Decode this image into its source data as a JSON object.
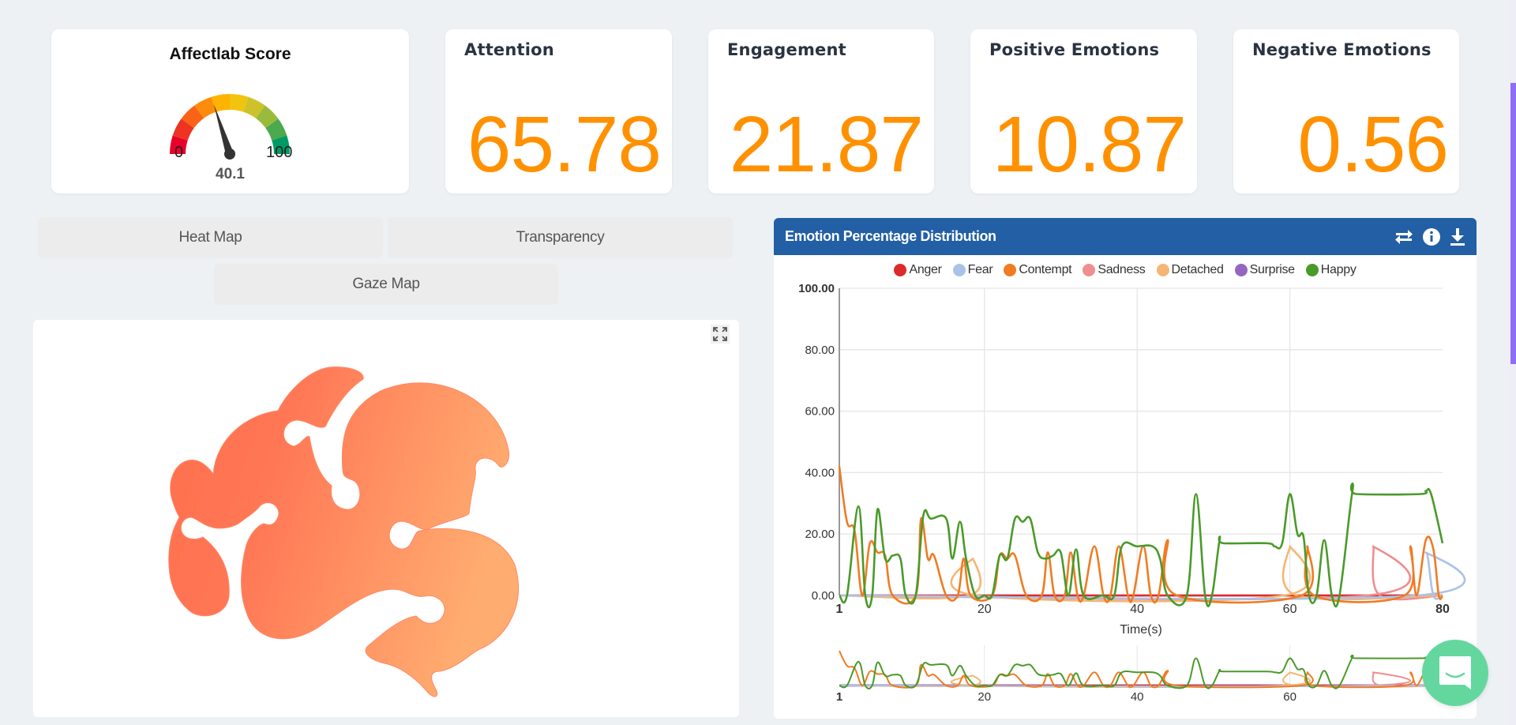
{
  "score_card": {
    "title": "Affectlab Score",
    "min_label": "0",
    "max_label": "100",
    "value": 40.1,
    "value_label": "40.1",
    "gauge_colors": [
      "#e8002a",
      "#ee3322",
      "#fa6216",
      "#fd8c0c",
      "#feb300",
      "#f1c40f",
      "#cdc22a",
      "#99bb3c",
      "#4ca94e",
      "#009a62"
    ]
  },
  "kpis": [
    {
      "title": "Attention",
      "value": "65.78"
    },
    {
      "title": "Engagement",
      "value": "21.87"
    },
    {
      "title": "Positive Emotions",
      "value": "10.87"
    },
    {
      "title": "Negative Emotions",
      "value": "0.56"
    }
  ],
  "view_buttons": {
    "heat_map": "Heat Map",
    "transparency": "Transparency",
    "gaze_map": "Gaze Map"
  },
  "image_panel": {
    "expand_icon": "expand-icon",
    "image": "brain-logo"
  },
  "chart_panel": {
    "title": "Emotion Percentage Distribution",
    "icons": [
      "swap-icon",
      "info-icon",
      "download-icon"
    ]
  },
  "chat_button": {
    "icon": "chat-bubble-icon"
  },
  "chart_data": {
    "type": "line",
    "title": "Emotion Percentage Distribution",
    "xlabel": "Time(s)",
    "ylabel": "",
    "xlim": [
      1,
      80
    ],
    "ylim": [
      0,
      100
    ],
    "xticks": [
      "1",
      "20",
      "40",
      "60",
      "80"
    ],
    "yticks": [
      "0.00",
      "20.00",
      "40.00",
      "60.00",
      "80.00",
      "100.00"
    ],
    "grid": true,
    "legend_position": "top",
    "navigator_xticks": [
      "1",
      "20",
      "40",
      "60"
    ],
    "series": [
      {
        "name": "Anger",
        "color": "#dd2a2a",
        "points": [
          [
            1,
            0
          ],
          [
            80,
            0
          ]
        ]
      },
      {
        "name": "Fear",
        "color": "#a9c3e8",
        "points": [
          [
            1,
            0
          ],
          [
            76.5,
            0
          ],
          [
            77.8,
            14
          ],
          [
            78.8,
            0
          ],
          [
            80,
            0
          ]
        ]
      },
      {
        "name": "Contempt",
        "color": "#f07b22",
        "points": [
          [
            1,
            42
          ],
          [
            2,
            24
          ],
          [
            3,
            21
          ],
          [
            4,
            0
          ],
          [
            5,
            17
          ],
          [
            6,
            14
          ],
          [
            7,
            13
          ],
          [
            8,
            0
          ],
          [
            11,
            0
          ],
          [
            11.7,
            25
          ],
          [
            12.6,
            12
          ],
          [
            13.4,
            13
          ],
          [
            15,
            0
          ],
          [
            16.5,
            0
          ],
          [
            17.3,
            12
          ],
          [
            18.2,
            0
          ],
          [
            21,
            0
          ],
          [
            22,
            13
          ],
          [
            23,
            12
          ],
          [
            24,
            13
          ],
          [
            25.5,
            0
          ],
          [
            27.5,
            0
          ],
          [
            28.3,
            14
          ],
          [
            29.2,
            0
          ],
          [
            30.5,
            0
          ],
          [
            31.3,
            14
          ],
          [
            32.2,
            0
          ],
          [
            33,
            0
          ],
          [
            34.4,
            16
          ],
          [
            35.6,
            0
          ],
          [
            36.5,
            0
          ],
          [
            37.6,
            16
          ],
          [
            38.8,
            0
          ],
          [
            39.5,
            0
          ],
          [
            40.8,
            16
          ],
          [
            41.8,
            0
          ],
          [
            42.8,
            0
          ],
          [
            44,
            18
          ],
          [
            45.2,
            0
          ],
          [
            61.5,
            0
          ],
          [
            62.3,
            16
          ],
          [
            63.2,
            0
          ],
          [
            75,
            0
          ],
          [
            75.8,
            16
          ],
          [
            76.6,
            0
          ],
          [
            77.8,
            18
          ],
          [
            78.8,
            15
          ],
          [
            79.5,
            0
          ],
          [
            80,
            0
          ]
        ]
      },
      {
        "name": "Sadness",
        "color": "#ef8e8e",
        "points": [
          [
            1,
            0
          ],
          [
            70,
            0
          ],
          [
            70.9,
            16
          ],
          [
            71.8,
            0
          ],
          [
            80,
            0
          ]
        ]
      },
      {
        "name": "Detached",
        "color": "#f5b574",
        "points": [
          [
            1,
            0
          ],
          [
            18,
            0
          ],
          [
            18.5,
            12
          ],
          [
            19,
            0
          ],
          [
            59.2,
            0
          ],
          [
            60,
            16
          ],
          [
            60.9,
            0
          ],
          [
            80,
            0
          ]
        ]
      },
      {
        "name": "Surprise",
        "color": "#9466c0",
        "points": [
          [
            1,
            0
          ],
          [
            80,
            0
          ]
        ]
      },
      {
        "name": "Happy",
        "color": "#4a9a2a",
        "points": [
          [
            1,
            0
          ],
          [
            2,
            0
          ],
          [
            3.5,
            29
          ],
          [
            4.4,
            0
          ],
          [
            5.3,
            0
          ],
          [
            6,
            28
          ],
          [
            7,
            12
          ],
          [
            8,
            13
          ],
          [
            9,
            12
          ],
          [
            9.7,
            0
          ],
          [
            11,
            0
          ],
          [
            12,
            26
          ],
          [
            13,
            25
          ],
          [
            15,
            25
          ],
          [
            15.8,
            12
          ],
          [
            16.8,
            24
          ],
          [
            17.6,
            12
          ],
          [
            18.8,
            0
          ],
          [
            20,
            0
          ],
          [
            21,
            0
          ],
          [
            22,
            13
          ],
          [
            23,
            12
          ],
          [
            24,
            25
          ],
          [
            25,
            24
          ],
          [
            26,
            25
          ],
          [
            27,
            14
          ],
          [
            28,
            12
          ],
          [
            29,
            13
          ],
          [
            30,
            14
          ],
          [
            31,
            0
          ],
          [
            32,
            15
          ],
          [
            33,
            0
          ],
          [
            35.5,
            0
          ],
          [
            37,
            0
          ],
          [
            38,
            16
          ],
          [
            40,
            16
          ],
          [
            42,
            16
          ],
          [
            43,
            12
          ],
          [
            44,
            0
          ],
          [
            46.5,
            0
          ],
          [
            47.7,
            33
          ],
          [
            48.9,
            0
          ],
          [
            49.8,
            0
          ],
          [
            50.8,
            18
          ],
          [
            51.3,
            17
          ],
          [
            57,
            17
          ],
          [
            58,
            16
          ],
          [
            59,
            17
          ],
          [
            60,
            33
          ],
          [
            61,
            20
          ],
          [
            61.8,
            19
          ],
          [
            62.5,
            0
          ],
          [
            63.5,
            0
          ],
          [
            64.5,
            18
          ],
          [
            65.5,
            0
          ],
          [
            66.5,
            0
          ],
          [
            68.2,
            34
          ],
          [
            68.8,
            33
          ],
          [
            77,
            33
          ],
          [
            77.8,
            34
          ],
          [
            78.5,
            33
          ],
          [
            80,
            17
          ]
        ]
      }
    ]
  }
}
